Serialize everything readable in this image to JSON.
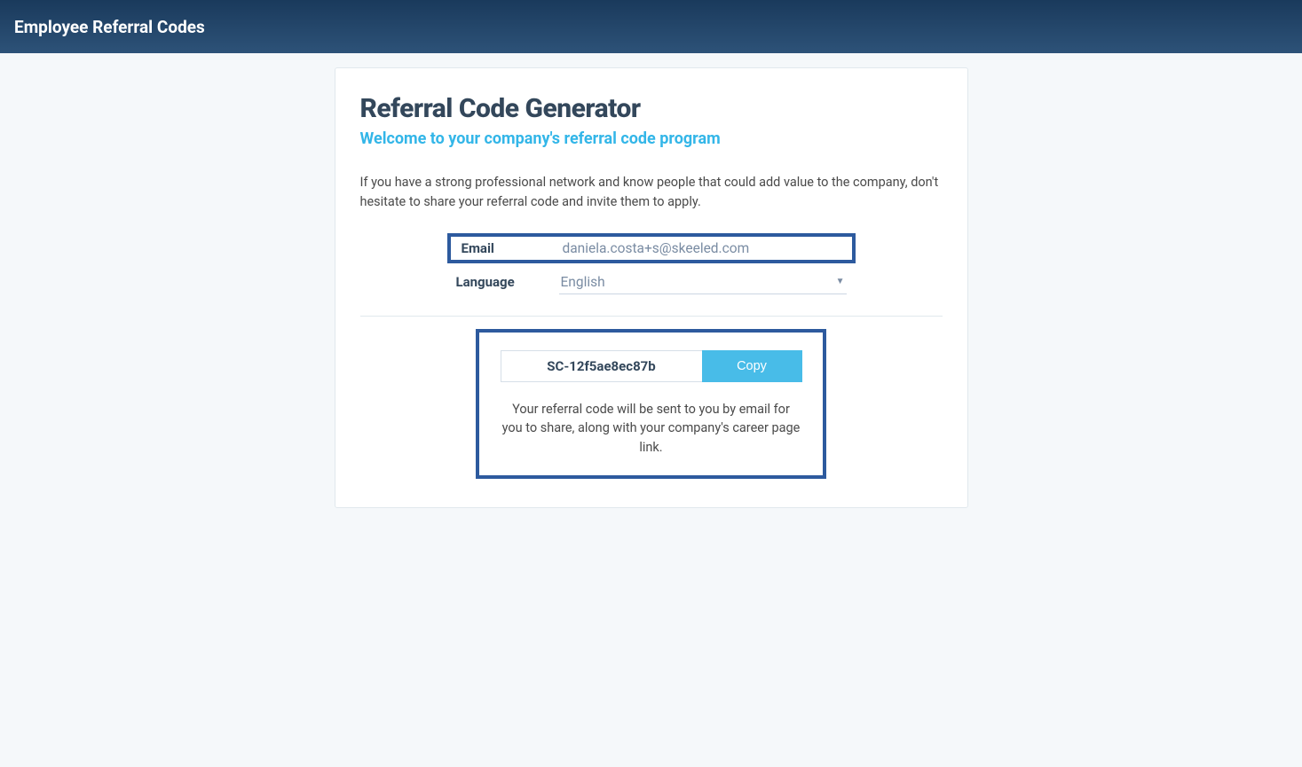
{
  "header": {
    "title": "Employee Referral Codes"
  },
  "card": {
    "title": "Referral Code Generator",
    "subtitle": "Welcome to your company's referral code program",
    "description": "If you have a strong professional network and know people that could add value to the company, don't hesitate to share your referral code and invite them to apply."
  },
  "form": {
    "email_label": "Email",
    "email_value": "daniela.costa+s@skeeled.com",
    "language_label": "Language",
    "language_value": "English"
  },
  "result": {
    "code": "SC-12f5ae8ec87b",
    "copy_label": "Copy",
    "note": "Your referral code will be sent to you by email for you to share, along with your company's career page link."
  }
}
